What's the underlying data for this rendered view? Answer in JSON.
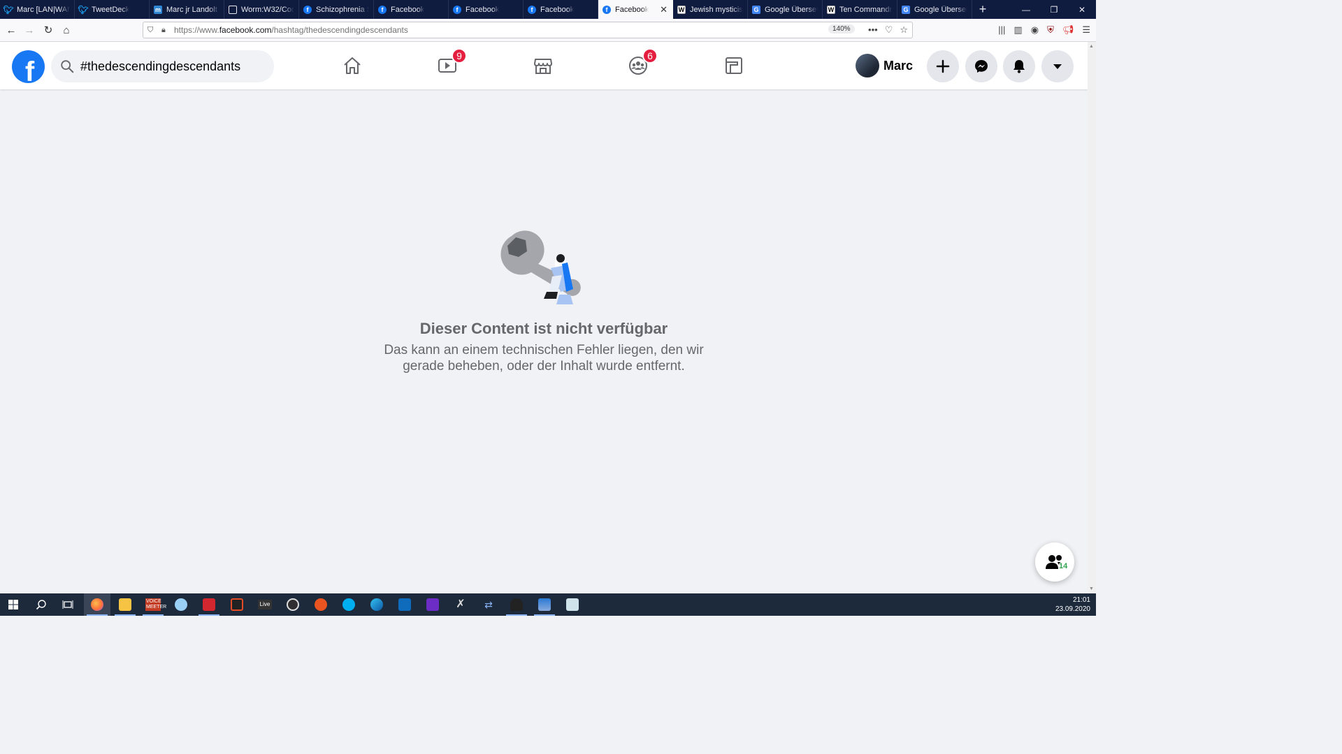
{
  "browser": {
    "tabs": [
      {
        "label": "Marc [LAN|WAN",
        "icon": "twitter-icon"
      },
      {
        "label": "TweetDeck",
        "icon": "tweetdeck-icon"
      },
      {
        "label": "Marc jr Landolt (",
        "icon": "mastodon-icon"
      },
      {
        "label": "Worm:W32/Cod",
        "icon": "shield-icon"
      },
      {
        "label": "Schizophrenia S",
        "icon": "facebook-icon"
      },
      {
        "label": "Facebook",
        "icon": "facebook-icon"
      },
      {
        "label": "Facebook",
        "icon": "facebook-icon"
      },
      {
        "label": "Facebook",
        "icon": "facebook-icon"
      },
      {
        "label": "Facebook",
        "icon": "facebook-icon",
        "active": true
      },
      {
        "label": "Jewish mysticism",
        "icon": "wikipedia-icon"
      },
      {
        "label": "Google Übersetz",
        "icon": "google-translate-icon"
      },
      {
        "label": "Ten Commandm",
        "icon": "wikipedia-icon"
      },
      {
        "label": "Google Übersetz",
        "icon": "google-translate-icon"
      }
    ],
    "url_prefix": "https://www.",
    "url_domain": "facebook.com",
    "url_path": "/hashtag/thedescendingdescendants",
    "zoom": "140%"
  },
  "facebook": {
    "search_value": "#thedescendingdescendants",
    "watch_badge": "9",
    "groups_badge": "6",
    "profile_name": "Marc",
    "contacts_count": "14"
  },
  "content": {
    "title": "Dieser Content ist nicht verfügbar",
    "message": "Das kann an einem technischen Fehler liegen, den wir gerade beheben, oder der Inhalt wurde entfernt."
  },
  "taskbar": {
    "time": "21:01",
    "date": "23.09.2020",
    "voicemeeter_label": "VOICE MEETER",
    "live_label": "Live"
  },
  "colors": {
    "facebook_blue": "#1877f2",
    "badge_red": "#e41e3f",
    "page_bg": "#f0f2f5",
    "tabstrip_bg": "#0f1b3f",
    "taskbar_bg": "#1d2a3c"
  }
}
